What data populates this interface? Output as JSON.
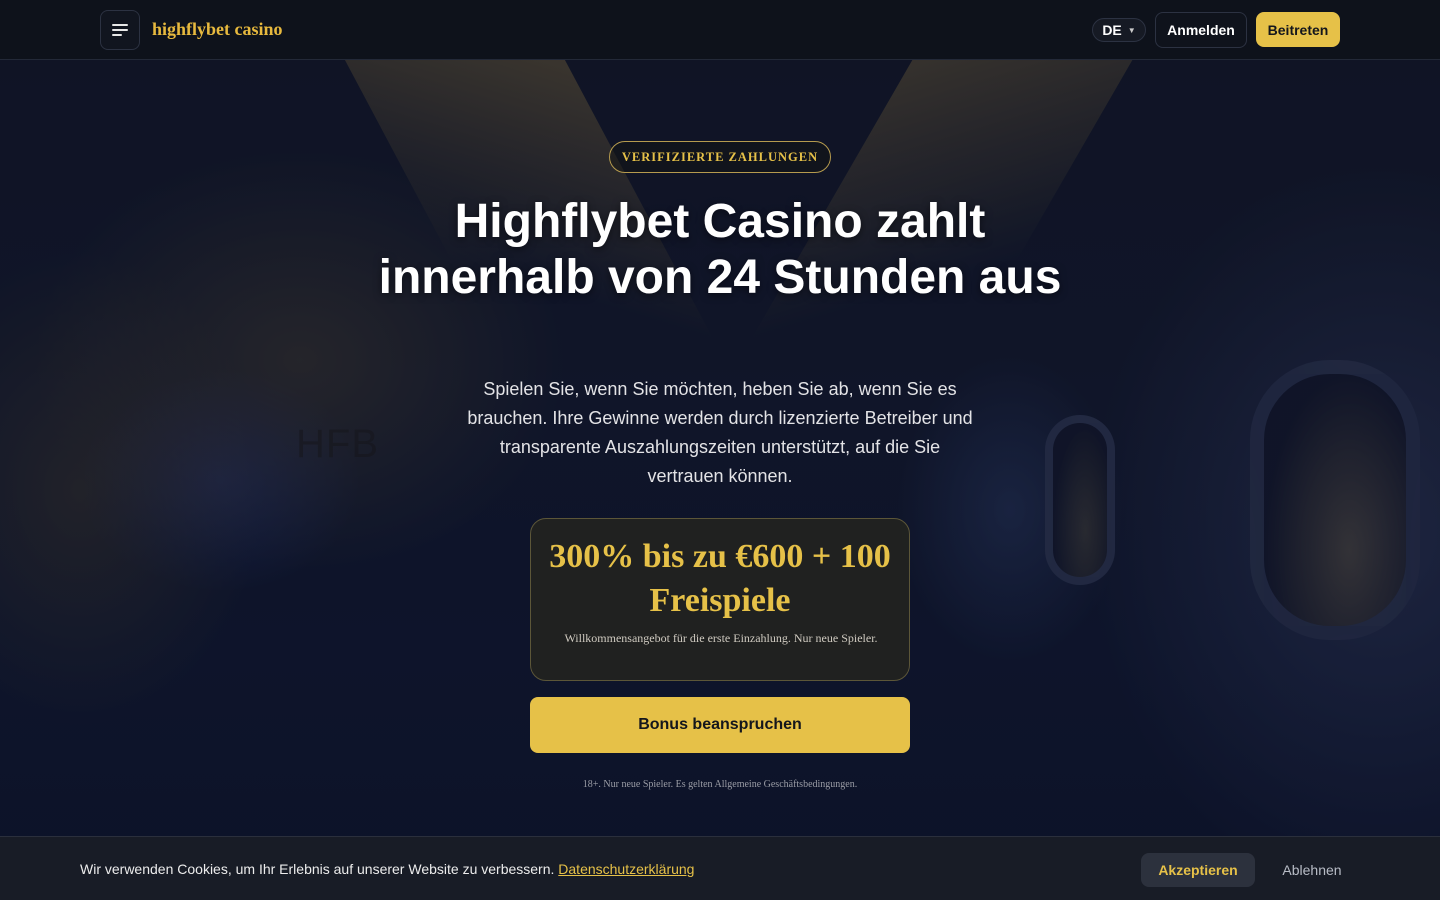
{
  "header": {
    "brand": "highflybet casino",
    "language": "DE",
    "login_label": "Anmelden",
    "join_label": "Beitreten"
  },
  "hero": {
    "background_watermark": "HFB",
    "badge": "VERIFIZIERTE ZAHLUNGEN",
    "title": "Highflybet Casino zahlt innerhalb von 24 Stunden aus",
    "subtitle": "Spielen Sie, wenn Sie möchten, heben Sie ab, wenn Sie es brauchen. Ihre Gewinne werden durch lizenzierte Betreiber und transparente Auszahlungszeiten unterstützt, auf die Sie vertrauen können.",
    "bonus": {
      "amount": "300% bis zu €600 + 100 Freispiele",
      "note": "Willkommensangebot für die erste Einzahlung. Nur neue Spieler."
    },
    "cta_label": "Bonus beanspruchen",
    "disclaimer": "18+. Nur neue Spieler. Es gelten Allgemeine Geschäftsbedingungen."
  },
  "cookie": {
    "text": "Wir verwenden Cookies, um Ihr Erlebnis auf unserer Website zu verbessern.",
    "link_label": "Datenschutzerklärung",
    "accept_label": "Akzeptieren",
    "decline_label": "Ablehnen"
  },
  "colors": {
    "accent": "#e6c148",
    "header_bg": "#0e121b",
    "cookie_bg": "#181c26"
  },
  "icons": {
    "menu": "menu-icon",
    "language_caret": "caret-down-icon"
  }
}
